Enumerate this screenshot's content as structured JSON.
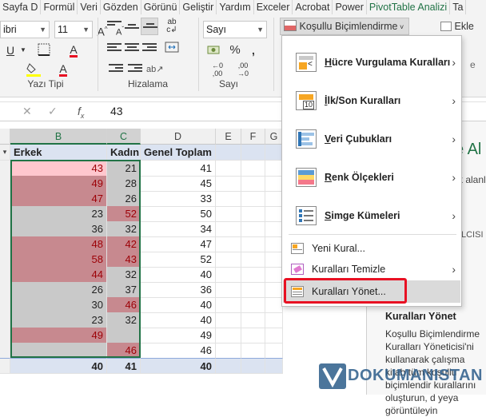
{
  "ribbon_tabs": [
    "Sayfa D",
    "Formül",
    "Veri",
    "Gözden",
    "Görünü",
    "Geliştir",
    "Yardım",
    "Exceler",
    "Acrobat",
    "Power",
    "PivotTable Analizi",
    "Ta"
  ],
  "font": {
    "name": "ibri",
    "size": "11"
  },
  "number_format": "Sayı",
  "groups": {
    "font": "Yazı Tipi",
    "alignment": "Hizalama",
    "number": "Sayı"
  },
  "cond_format_button": "Koşullu Biçimlendirme",
  "insert_button": "Ekle",
  "formula_bar": {
    "value": "43"
  },
  "col_headers": [
    "B",
    "C",
    "D",
    "E",
    "F",
    "G"
  ],
  "table": {
    "headers": [
      "Erkek",
      "Kadın",
      "Genel Toplam"
    ],
    "rows": [
      [
        "43",
        "21",
        "41"
      ],
      [
        "49",
        "28",
        "45"
      ],
      [
        "47",
        "26",
        "33"
      ],
      [
        "23",
        "52",
        "50"
      ],
      [
        "36",
        "32",
        "34"
      ],
      [
        "48",
        "42",
        "47"
      ],
      [
        "58",
        "43",
        "52"
      ],
      [
        "44",
        "32",
        "40"
      ],
      [
        "26",
        "37",
        "36"
      ],
      [
        "30",
        "46",
        "40"
      ],
      [
        "23",
        "32",
        "40"
      ],
      [
        "49",
        "",
        "49"
      ],
      [
        "",
        "46",
        "46"
      ]
    ],
    "totals": [
      "40",
      "41",
      "40"
    ]
  },
  "menu": {
    "items": [
      {
        "label": "Hücre Vurgulama Kuralları",
        "underline": "H",
        "icon": "highlight-rules-icon"
      },
      {
        "label": "İlk/Son Kuralları",
        "underline": "İ",
        "icon": "top-bottom-rules-icon"
      },
      {
        "label": "Veri Çubukları",
        "underline": "V",
        "icon": "data-bars-icon"
      },
      {
        "label": "Renk Ölçekleri",
        "underline": "R",
        "icon": "color-scales-icon"
      },
      {
        "label": "Simge Kümeleri",
        "underline": "S",
        "icon": "icon-sets-icon"
      }
    ],
    "new_rule": "Yeni Kural...",
    "clear_rules": "Kuralları Temizle",
    "manage_rules": "Kuralları Yönet..."
  },
  "side_panel": {
    "heading_fragment": "e Al",
    "line1": "k alanl",
    "line2": "LCISI"
  },
  "tooltip": {
    "title": "Kuralları Yönet",
    "text": "Koşullu Biçimlendirme Kuralları Yöneticisi'ni kullanarak çalışma kitab tüm koşullu biçimlendir kurallarını oluşturun, d yeya görüntüleyin"
  },
  "watermark": "DOKUMANISTAN",
  "colors": {
    "excel_green": "#217346",
    "red_fill": "#c7898f",
    "pink_fill": "#ffc7ce",
    "highlight_red": "#e81123",
    "pivot_header": "#dbe3f1"
  }
}
